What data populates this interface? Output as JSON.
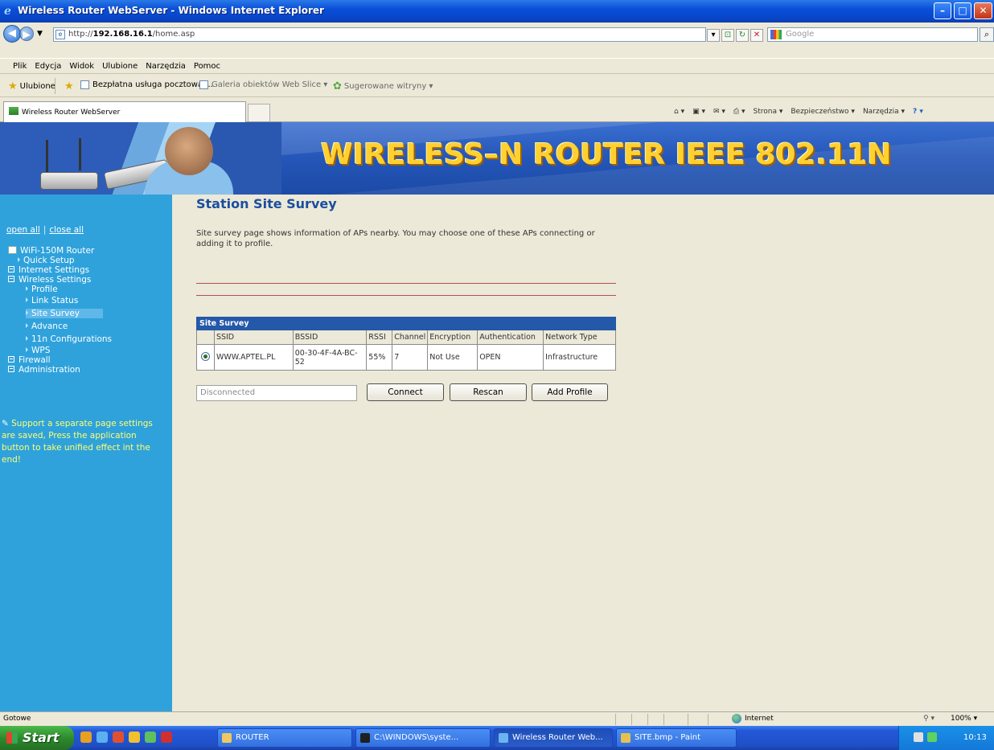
{
  "window": {
    "title": "Wireless Router WebServer - Windows Internet Explorer",
    "min_glyph": "–",
    "max_glyph": "□",
    "close_glyph": "✕"
  },
  "address": {
    "prefix": "http://",
    "host": "192.168.16.1",
    "path": "/home.asp",
    "search_placeholder": "Google"
  },
  "menu": [
    "Plik",
    "Edycja",
    "Widok",
    "Ulubione",
    "Narzędzia",
    "Pomoc"
  ],
  "favorites": {
    "ulubione": "Ulubione",
    "poczta": "Bezpłatna usługa pocztowa ...",
    "galeria": "Galeria obiektów Web Slice ▾",
    "sugerowane": "Sugerowane witryny ▾"
  },
  "tab": {
    "label": "Wireless Router WebServer"
  },
  "command_bar": {
    "strona": "Strona ▾",
    "bezpieczenstwo": "Bezpieczeństwo ▾",
    "narzedzia": "Narzędzia ▾"
  },
  "banner": {
    "title": "WIRELESS–N ROUTER  IEEE 802.11N"
  },
  "sidebar": {
    "open_all": "open all",
    "sep": "|",
    "close_all": "close all",
    "root": "WiFi-150M Router",
    "quick_setup": "Quick Setup",
    "internet_settings": "Internet Settings",
    "wireless_settings": "Wireless Settings",
    "profile": "Profile",
    "link_status": "Link Status",
    "site_survey": "Site Survey",
    "advance": "Advance",
    "configurations_11n": "11n Configurations",
    "wps": "WPS",
    "firewall": "Firewall",
    "administration": "Administration",
    "note": "Support a separate page settings are saved, Press the application button to take unified effect int the end!"
  },
  "page": {
    "title": "Station Site Survey",
    "description": "Site survey page shows information of APs nearby. You may choose one of these APs connecting or adding it to profile."
  },
  "survey": {
    "caption": "Site Survey",
    "columns": [
      "SSID",
      "BSSID",
      "RSSI",
      "Channel",
      "Encryption",
      "Authentication",
      "Network Type"
    ],
    "rows": [
      {
        "ssid": "WWW.APTEL.PL",
        "bssid": "00-30-4F-4A-BC-52",
        "rssi": "55%",
        "channel": "7",
        "encryption": "Not Use",
        "authentication": "OPEN",
        "network_type": "Infrastructure",
        "selected": true
      }
    ],
    "status_value": "Disconnected",
    "connect_label": "Connect",
    "rescan_label": "Rescan",
    "add_profile_label": "Add Profile"
  },
  "statusbar": {
    "text": "Gotowe",
    "zone": "Internet",
    "zoom": "100%  ▾"
  },
  "taskbar": {
    "start_label": "Start",
    "tasks": [
      "ROUTER",
      "C:\\WINDOWS\\syste...",
      "Wireless Router Web...",
      "SITE.bmp - Paint"
    ],
    "time": "10:13"
  },
  "colors": {
    "sidebar_bg": "#2fa2dc",
    "title_blue": "#1a4ea0",
    "banner_yellow": "#ffd030",
    "table_header": "#2458a8"
  }
}
